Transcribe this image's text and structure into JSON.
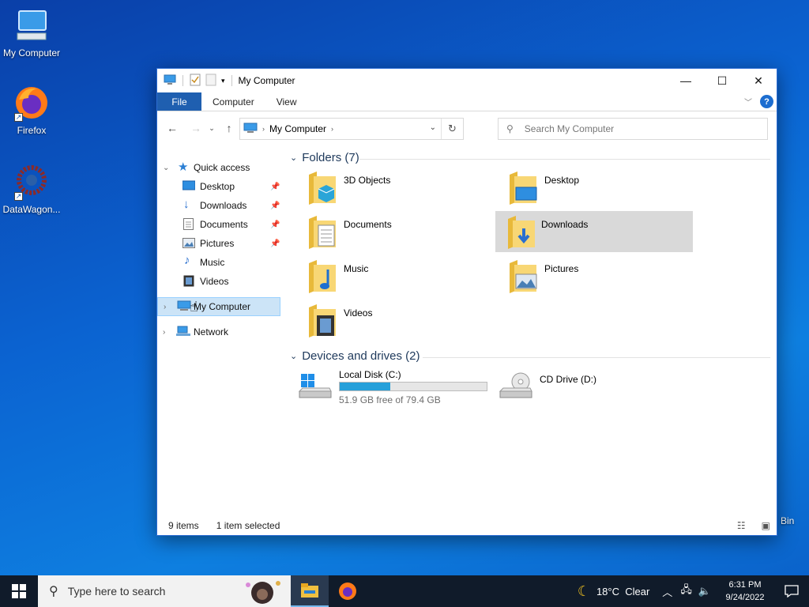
{
  "desktop": {
    "icons": [
      {
        "label": "My Computer"
      },
      {
        "label": "Firefox"
      },
      {
        "label": "DataWagon..."
      }
    ],
    "recycle_label": "Bin"
  },
  "window": {
    "title": "My Computer",
    "ribbon_tabs": [
      "File",
      "Computer",
      "View"
    ],
    "address": "My Computer",
    "search_placeholder": "Search My Computer"
  },
  "nav_pane": {
    "quick_access": "Quick access",
    "items": [
      "Desktop",
      "Downloads",
      "Documents",
      "Pictures",
      "Music",
      "Videos"
    ],
    "my_computer": "My Computer",
    "network": "Network"
  },
  "content": {
    "folders_header": "Folders (7)",
    "folders": [
      "3D Objects",
      "Desktop",
      "Documents",
      "Downloads",
      "Music",
      "Pictures",
      "Videos"
    ],
    "selected_folder": "Downloads",
    "drives_header": "Devices and drives (2)",
    "drives": [
      {
        "name": "Local Disk (C:)",
        "free": "51.9 GB free of 79.4 GB",
        "used_fraction": 0.346
      },
      {
        "name": "CD Drive (D:)"
      }
    ]
  },
  "status": {
    "items": "9 items",
    "selected": "1 item selected"
  },
  "taskbar": {
    "search_placeholder": "Type here to search",
    "weather": "18°C  Clear",
    "time": "6:31 PM",
    "date": "9/24/2022"
  },
  "colors": {
    "accent": "#1f5fb0",
    "selection": "#cce4f7",
    "drive_bar": "#26a0da"
  }
}
